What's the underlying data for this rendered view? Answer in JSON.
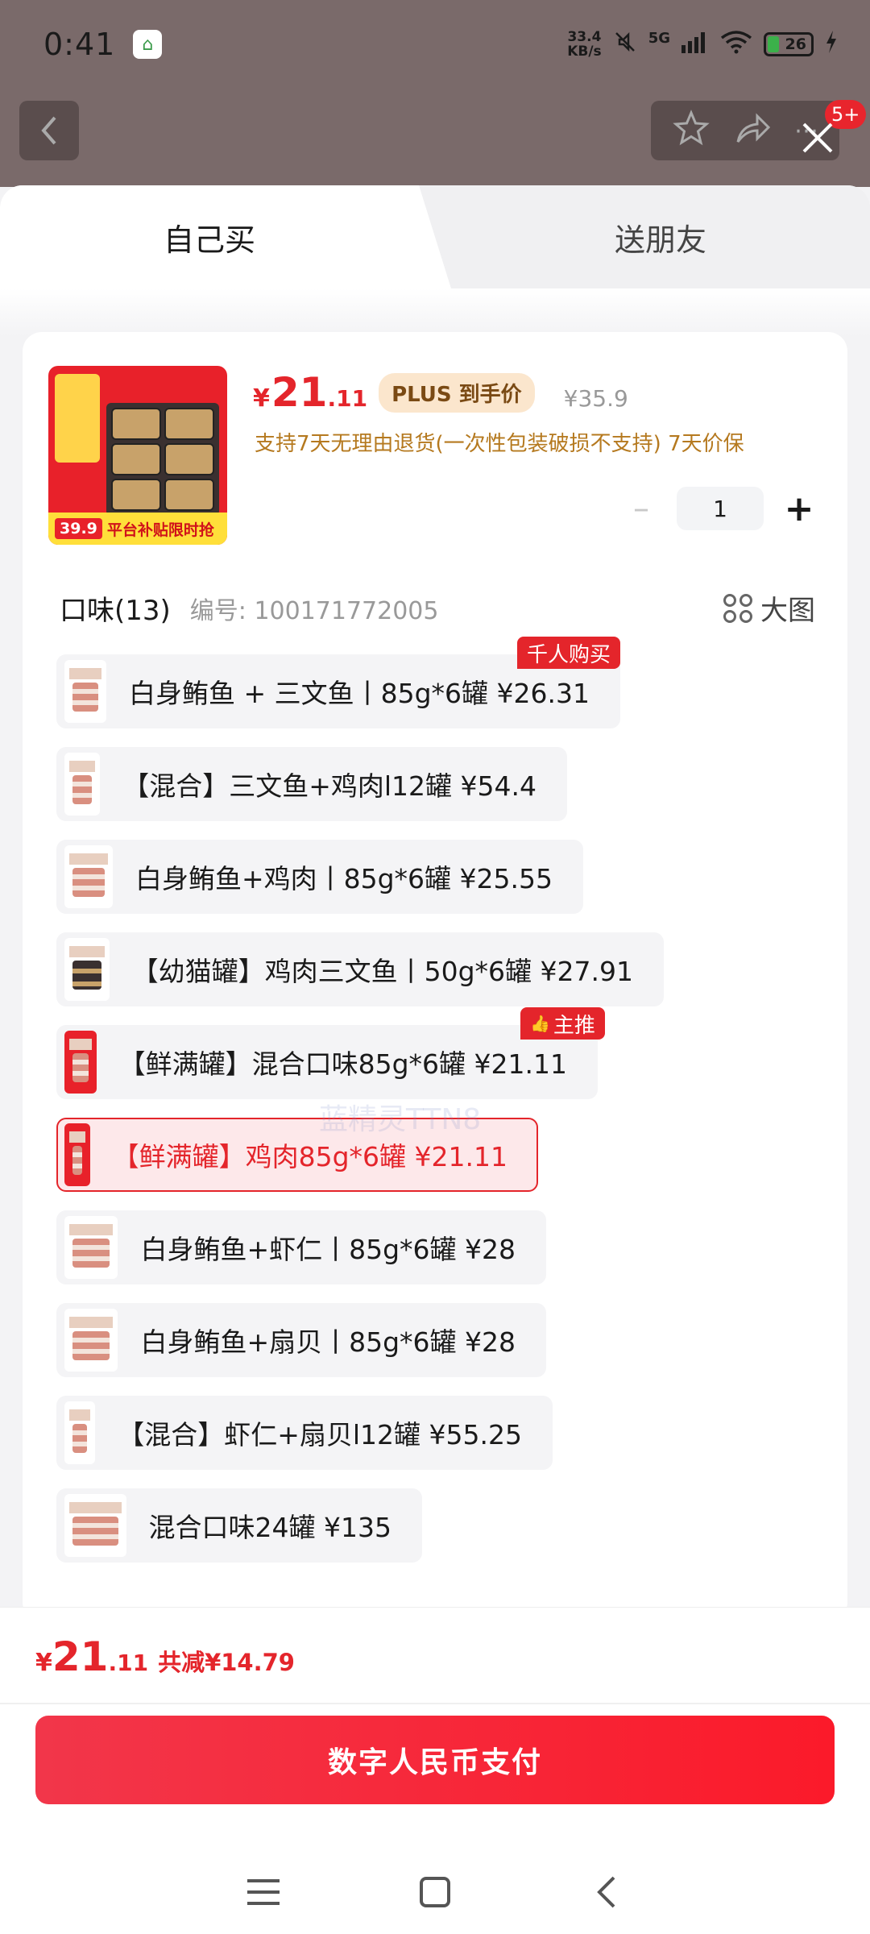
{
  "status_bar": {
    "time": "0:41",
    "net_speed_value": "33.4",
    "net_speed_unit": "KB/s",
    "network": "5G",
    "battery": "26"
  },
  "header": {
    "more_badge": "5+"
  },
  "tabs": {
    "buy_self": "自己买",
    "gift_friend": "送朋友"
  },
  "product": {
    "thumb_price": "39.9",
    "thumb_banner": "平台补贴限时抢",
    "price_currency": "¥",
    "price_int": "21",
    "price_dec": ".11",
    "plus_tag": "PLUS 到手价",
    "original_price": "¥35.9",
    "service_text": "支持7天无理由退货(一次性包装破损不支持) 7天价保",
    "quantity": "1"
  },
  "spec": {
    "title": "口味(13)",
    "code": "编号: 100171772005",
    "big_view": "大图",
    "options": [
      {
        "label": "白身鲔鱼 + 三文鱼丨85g*6罐   ¥26.31",
        "badge": "千人购买"
      },
      {
        "label": "【混合】三文鱼+鸡肉l12罐   ¥54.4"
      },
      {
        "label": "白身鲔鱼+鸡肉丨85g*6罐   ¥25.55"
      },
      {
        "label": "【幼猫罐】鸡肉三文鱼丨50g*6罐   ¥27.91"
      },
      {
        "label": "【鲜满罐】混合口味85g*6罐   ¥21.11",
        "badge": "主推"
      },
      {
        "label": "【鲜满罐】鸡肉85g*6罐   ¥21.11",
        "selected": true
      },
      {
        "label": "白身鲔鱼+虾仁丨85g*6罐   ¥28"
      },
      {
        "label": "白身鲔鱼+扇贝丨85g*6罐   ¥28"
      },
      {
        "label": "【混合】虾仁+扇贝l12罐   ¥55.25"
      },
      {
        "label": "混合口味24罐   ¥135"
      }
    ]
  },
  "watermark": "蓝精灵TTN8",
  "footer": {
    "total_currency": "¥",
    "total_int": "21",
    "total_dec": ".11",
    "saved": "共减¥14.79",
    "pay_button": "数字人民币支付"
  },
  "colors": {
    "accent": "#e4252b",
    "plus_tag_bg": "#fbe6cd",
    "service_text": "#b5791f"
  }
}
